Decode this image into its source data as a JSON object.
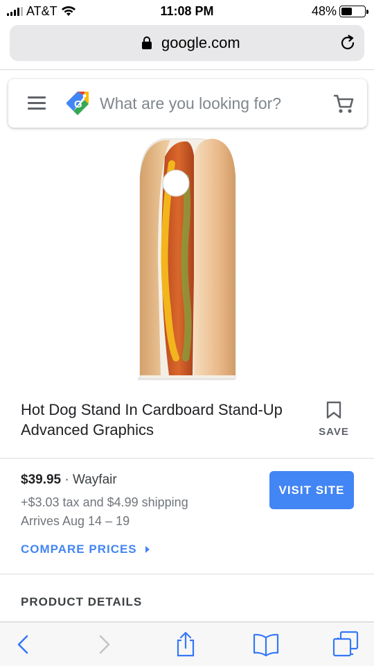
{
  "status_bar": {
    "carrier": "AT&T",
    "time": "11:08 PM",
    "battery_percent": "48%",
    "battery_level": 0.48,
    "signal_bars": 4
  },
  "browser": {
    "url": "google.com"
  },
  "search": {
    "placeholder": "What are you looking for?"
  },
  "product": {
    "title": "Hot Dog Stand In Cardboard Stand-Up Advanced Graphics",
    "save_label": "SAVE",
    "image_icon": "hot-dog-cardboard-standup"
  },
  "offer": {
    "price": "$39.95",
    "separator": "·",
    "seller": "Wayfair",
    "tax_shipping": "+$3.03 tax and $4.99 shipping",
    "arrives": "Arrives Aug 14 – 19",
    "visit_label": "VISIT SITE",
    "compare_label": "COMPARE PRICES"
  },
  "sections": {
    "product_details": "PRODUCT DETAILS"
  },
  "colors": {
    "accent_blue": "#4285f4",
    "url_bar_bg": "#e8e8ea",
    "toolbar_icon_blue": "#3478f6"
  },
  "toolbar": {
    "icons": [
      "back-icon",
      "forward-icon",
      "share-icon",
      "bookmarks-icon",
      "tabs-icon"
    ]
  }
}
